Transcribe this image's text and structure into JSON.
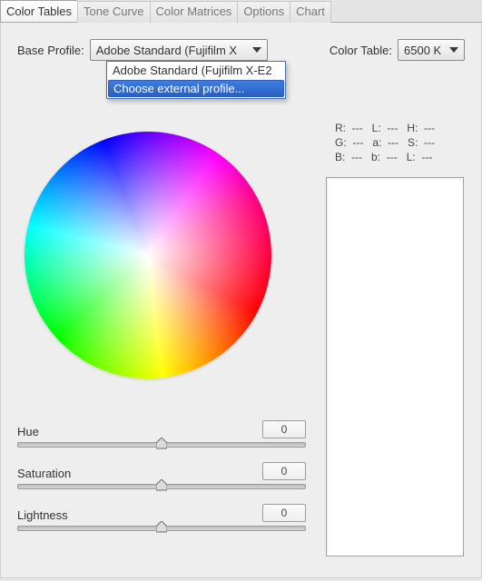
{
  "tabs": [
    {
      "label": "Color Tables",
      "active": true
    },
    {
      "label": "Tone Curve",
      "active": false
    },
    {
      "label": "Color Matrices",
      "active": false
    },
    {
      "label": "Options",
      "active": false
    },
    {
      "label": "Chart",
      "active": false
    }
  ],
  "base_profile": {
    "label": "Base Profile:",
    "selected": "Adobe Standard (Fujifilm X",
    "options": [
      "Adobe Standard (Fujifilm X-E2",
      "Choose external profile..."
    ],
    "highlighted_index": 1
  },
  "color_table": {
    "label": "Color Table:",
    "selected": "6500 K"
  },
  "readout": {
    "r": "---",
    "l_upper": "---",
    "h_upper": "---",
    "g": "---",
    "a": "---",
    "s": "---",
    "b": "---",
    "b_lower": "---",
    "l_lower": "---"
  },
  "sliders": {
    "hue": {
      "label": "Hue",
      "value": "0"
    },
    "saturation": {
      "label": "Saturation",
      "value": "0"
    },
    "lightness": {
      "label": "Lightness",
      "value": "0"
    }
  }
}
